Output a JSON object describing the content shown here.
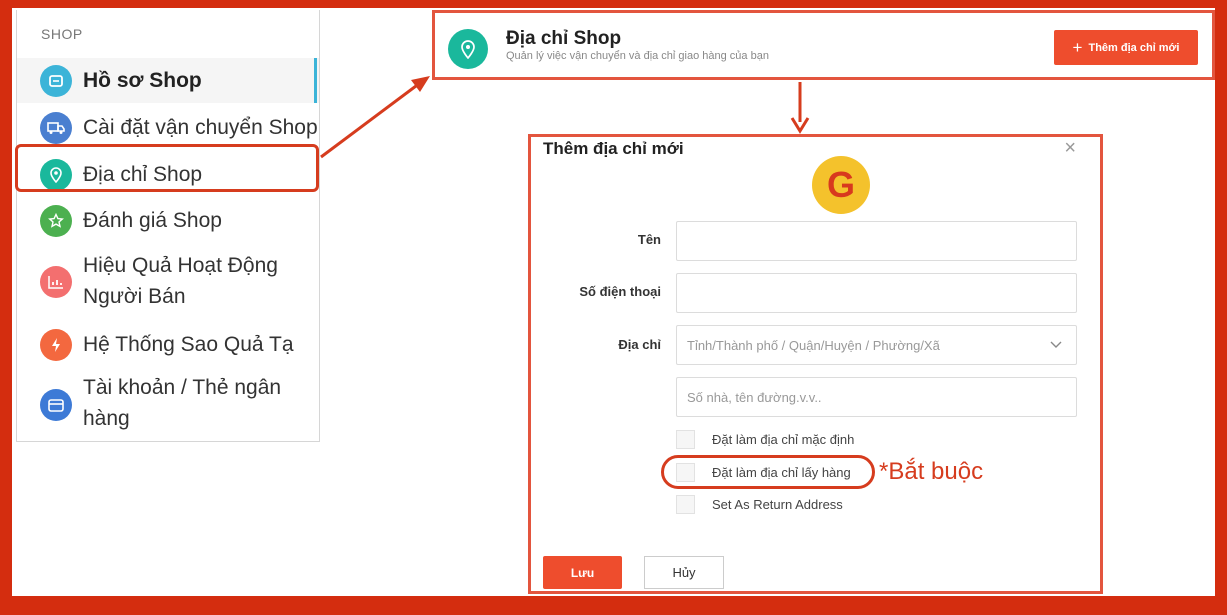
{
  "colors": {
    "frame": "#d42d0f",
    "accent": "#ee4d2d",
    "teal": "#1ab89c",
    "annotation": "#d63c1e"
  },
  "sidebar": {
    "header": "SHOP",
    "items": [
      {
        "label": "Hồ sơ Shop",
        "icon": "profile-icon",
        "color": "#3cb4d8",
        "active": true
      },
      {
        "label": "Cài đặt vận chuyển Shop",
        "icon": "truck-icon",
        "color": "#4a7fd0"
      },
      {
        "label": "Địa chỉ Shop",
        "icon": "location-pin-icon",
        "color": "#1ab89c"
      },
      {
        "label": "Đánh giá Shop",
        "icon": "star-icon",
        "color": "#4cb050"
      },
      {
        "label": "Hiệu Quả Hoạt Động",
        "label2": "Người Bán",
        "icon": "chart-icon",
        "color": "#f36f6f"
      },
      {
        "label": "Hệ Thống Sao Quả Tạ",
        "icon": "lightning-icon",
        "color": "#f3683f"
      },
      {
        "label": "Tài khoản / Thẻ ngân",
        "label2": "hàng",
        "icon": "card-icon",
        "color": "#3d7ad6"
      }
    ]
  },
  "header": {
    "title": "Địa chỉ Shop",
    "subtitle": "Quản lý việc vận chuyển và địa chỉ giao hàng của bạn",
    "add_button": "Thêm địa chỉ mới"
  },
  "dialog": {
    "title": "Thêm địa chỉ mới",
    "close": "×",
    "badge": "G",
    "fields": {
      "name_label": "Tên",
      "phone_label": "Số điện thoại",
      "address_label": "Địa chỉ",
      "region_placeholder": "Tỉnh/Thành phố / Quận/Huyện / Phường/Xã",
      "street_placeholder": "Số nhà, tên đường.v.v.."
    },
    "checkboxes": [
      {
        "label": "Đặt làm địa chỉ mặc định",
        "checked": false
      },
      {
        "label": "Đặt làm địa chỉ lấy hàng",
        "checked": false
      },
      {
        "label": "Set As Return Address",
        "checked": false
      }
    ],
    "required_note": "*Bắt buộc",
    "save_button": "Lưu",
    "cancel_button": "Hủy"
  }
}
